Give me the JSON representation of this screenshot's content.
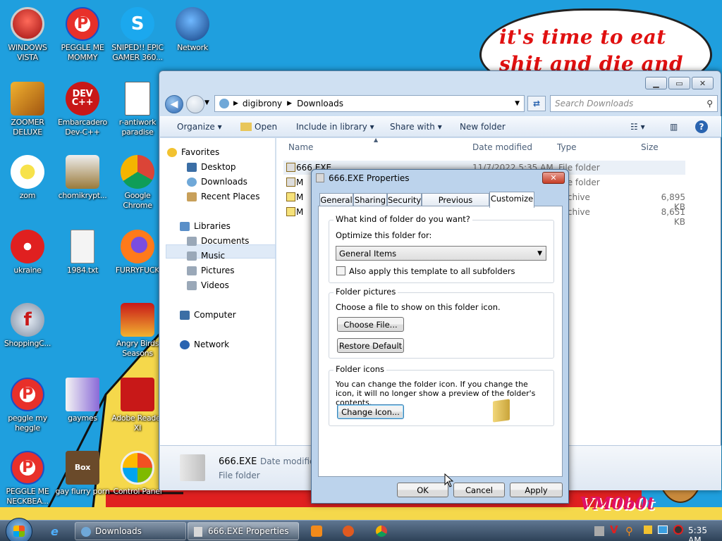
{
  "desktop": {
    "icons": [
      {
        "label": "WINDOWS VISTA",
        "icon": "vista-orb-icon"
      },
      {
        "label": "PEGGLE ME MOMMY",
        "icon": "peggle-icon"
      },
      {
        "label": "SNIPED!! EPIC GAMER 360...",
        "icon": "skype-icon"
      },
      {
        "label": "Network",
        "icon": "network-globe-icon"
      },
      {
        "label": "ZOOMER DELUXE",
        "icon": "zuma-icon"
      },
      {
        "label": "Embarcadero Dev-C++",
        "icon": "devcpp-icon"
      },
      {
        "label": "r-antiwork paradise",
        "icon": "html-file-icon"
      },
      {
        "label": "zom",
        "icon": "flower-icon"
      },
      {
        "label": "chomikrypt...",
        "icon": "app-icon"
      },
      {
        "label": "Google Chrome",
        "icon": "chrome-icon"
      },
      {
        "label": "ukraine",
        "icon": "radiation-icon"
      },
      {
        "label": "1984.txt",
        "icon": "text-file-icon"
      },
      {
        "label": "FURRYFUCK",
        "icon": "firefox-icon"
      },
      {
        "label": "ShoppingC...",
        "icon": "flash-icon"
      },
      {
        "label": "Angry Birds Seasons",
        "icon": "angry-birds-icon"
      },
      {
        "label": "peggle my heggle",
        "icon": "peggle-icon"
      },
      {
        "label": "gaymes",
        "icon": "folder-icon"
      },
      {
        "label": "Adobe Reader XI",
        "icon": "adobe-reader-icon"
      },
      {
        "label": "PEGGLE ME NECKBEA...",
        "icon": "peggle-icon"
      },
      {
        "label": "gay flurry porn",
        "icon": "box-icon"
      },
      {
        "label": "Control Panel",
        "icon": "control-panel-icon"
      }
    ],
    "bubble_text": "it's time to eat shit and die and chew",
    "watermark": "VM0b0t"
  },
  "explorer": {
    "breadcrumb": [
      "digibrony",
      "Downloads"
    ],
    "search_placeholder": "Search Downloads",
    "toolbar": {
      "organize": "Organize",
      "open": "Open",
      "include": "Include in library",
      "share": "Share with",
      "new_folder": "New folder"
    },
    "nav": {
      "favorites": "Favorites",
      "desktop": "Desktop",
      "downloads": "Downloads",
      "recent": "Recent Places",
      "libraries": "Libraries",
      "documents": "Documents",
      "music": "Music",
      "pictures": "Pictures",
      "videos": "Videos",
      "computer": "Computer",
      "network": "Network"
    },
    "columns": {
      "name": "Name",
      "date": "Date modified",
      "type": "Type",
      "size": "Size"
    },
    "files": [
      {
        "name": "666.EXE",
        "date": "11/7/2022 5:35 AM",
        "type": "File folder",
        "size": ""
      },
      {
        "name": "M",
        "date": "",
        "type": "File folder",
        "size": ""
      },
      {
        "name": "M",
        "date": "",
        "type": "Archive",
        "size": "6,895 KB"
      },
      {
        "name": "M",
        "date": "",
        "type": "Archive",
        "size": "8,651 KB"
      }
    ],
    "details": {
      "name": "666.EXE",
      "date_label": "Date modified",
      "type": "File folder"
    }
  },
  "dialog": {
    "title": "666.EXE Properties",
    "tabs": [
      "General",
      "Sharing",
      "Security",
      "Previous Versions",
      "Customize"
    ],
    "active_tab": "Customize",
    "group1": {
      "title": "What kind of folder do you want?",
      "optimize_label": "Optimize this folder for:",
      "optimize_value": "General Items",
      "apply_subfolders": "Also apply this template to all subfolders"
    },
    "group2": {
      "title": "Folder pictures",
      "desc": "Choose a file to show on this folder icon.",
      "choose_file": "Choose File...",
      "restore": "Restore Default"
    },
    "group3": {
      "title": "Folder icons",
      "desc": "You can change the folder icon. If you change the icon, it will no longer show a preview of the folder's contents.",
      "change_icon": "Change Icon..."
    },
    "ok": "OK",
    "cancel": "Cancel",
    "apply": "Apply"
  },
  "taskbar": {
    "tasks": [
      {
        "label": "Downloads",
        "icon": "explorer-icon"
      },
      {
        "label": "666.EXE Properties",
        "icon": "folder-icon"
      }
    ],
    "clock": "5:35 AM"
  }
}
